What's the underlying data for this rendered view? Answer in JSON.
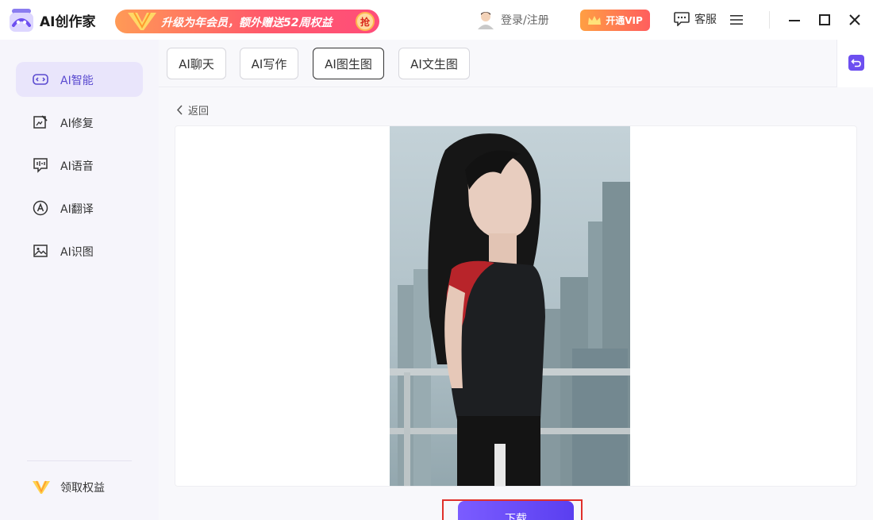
{
  "app": {
    "title": "AI创作家"
  },
  "promo": {
    "text": "升级为年会员，额外赠送52周权益",
    "badge": "抢"
  },
  "header": {
    "login_text": "登录/注册",
    "vip_label": "开通VIP",
    "service_label": "客服"
  },
  "sidebar": {
    "items": [
      {
        "label": "AI智能",
        "icon": "gamepad-icon",
        "active": true
      },
      {
        "label": "AI修复",
        "icon": "image-edit-icon",
        "active": false
      },
      {
        "label": "AI语音",
        "icon": "voice-message-icon",
        "active": false
      },
      {
        "label": "AI翻译",
        "icon": "translate-icon",
        "active": false
      },
      {
        "label": "AI识图",
        "icon": "image-recognize-icon",
        "active": false
      }
    ],
    "benefit_label": "领取权益"
  },
  "tabs": [
    {
      "label": "AI聊天",
      "active": false
    },
    {
      "label": "AI写作",
      "active": false
    },
    {
      "label": "AI图生图",
      "active": true
    },
    {
      "label": "AI文生图",
      "active": false
    }
  ],
  "main": {
    "back_label": "返回",
    "download_label": "下载"
  },
  "colors": {
    "accent": "#6d4ff0",
    "active_bg": "#e9e5fb",
    "promo_start": "#ff9a56",
    "promo_end": "#ff4d7a",
    "highlight_frame": "#e0302a"
  }
}
